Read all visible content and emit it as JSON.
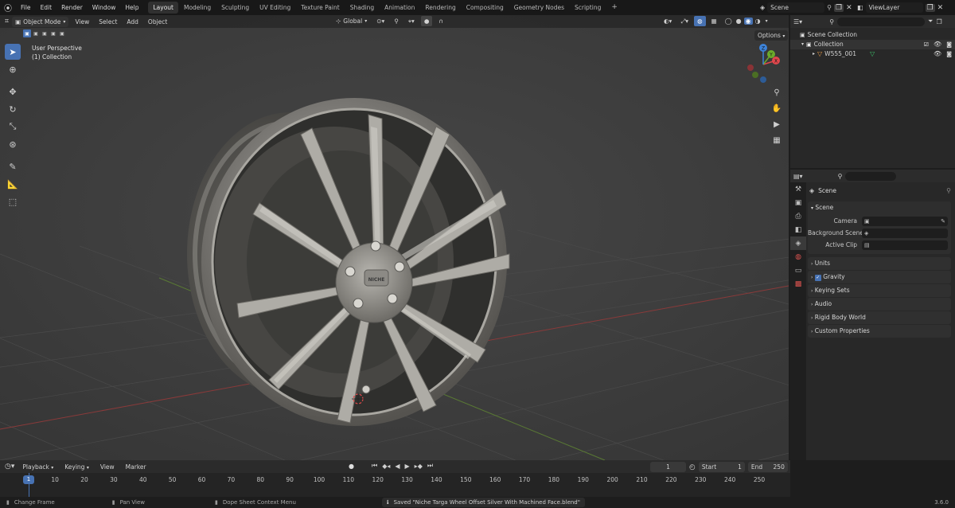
{
  "topbar": {
    "menus": [
      "File",
      "Edit",
      "Render",
      "Window",
      "Help"
    ],
    "workspaces": [
      "Layout",
      "Modeling",
      "Sculpting",
      "UV Editing",
      "Texture Paint",
      "Shading",
      "Animation",
      "Rendering",
      "Compositing",
      "Geometry Nodes",
      "Scripting"
    ],
    "active_workspace": "Layout",
    "add_workspace": "+",
    "scene_name": "Scene",
    "view_layer": "ViewLayer"
  },
  "viewport": {
    "mode": "Object Mode",
    "menus": [
      "View",
      "Select",
      "Add",
      "Object"
    ],
    "transform_orientation": "Global",
    "options_label": "Options",
    "overlay_title": "User Perspective",
    "overlay_collection": "(1) Collection",
    "gizmo_axes": {
      "x": "X",
      "y": "Y",
      "z": "Z"
    },
    "hub_logo_text": "NICHE"
  },
  "outliner": {
    "scene_collection": "Scene Collection",
    "collection": "Collection",
    "object": "W555_001"
  },
  "properties": {
    "context": "Scene",
    "scene_panel": "Scene",
    "fields": [
      {
        "label": "Camera",
        "value": ""
      },
      {
        "label": "Background Scene",
        "value": ""
      },
      {
        "label": "Active Clip",
        "value": ""
      }
    ],
    "panels": [
      "Units",
      "Gravity",
      "Keying Sets",
      "Audio",
      "Rigid Body World",
      "Custom Properties"
    ],
    "gravity_checked": true
  },
  "timeline": {
    "menus": [
      "Playback",
      "Keying",
      "View",
      "Marker"
    ],
    "current_frame": "1",
    "start_label": "Start",
    "start": "1",
    "end_label": "End",
    "end": "250",
    "ticks": [
      "1",
      "10",
      "20",
      "30",
      "40",
      "50",
      "60",
      "70",
      "80",
      "90",
      "100",
      "110",
      "120",
      "130",
      "140",
      "150",
      "160",
      "170",
      "180",
      "190",
      "200",
      "210",
      "220",
      "230",
      "240",
      "250"
    ]
  },
  "status": {
    "left": "Change Frame",
    "middle": "Pan View",
    "context_menu": "Dope Sheet Context Menu",
    "message": "Saved \"Niche Targa Wheel Offset Silver With Machined Face.blend\"",
    "version": "3.6.0"
  },
  "colors": {
    "accent": "#4772b3",
    "x_axis": "#e0474c",
    "y_axis": "#6bab2b",
    "z_axis": "#3d83d9"
  }
}
